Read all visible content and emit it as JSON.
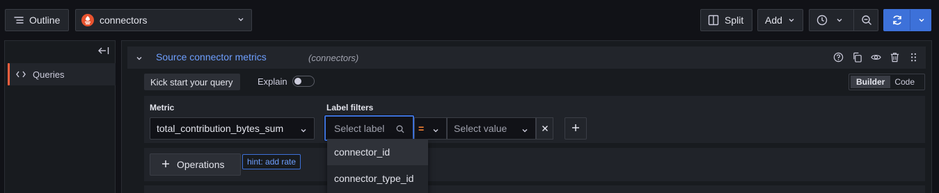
{
  "toolbar": {
    "outline_label": "Outline",
    "datasource_name": "connectors",
    "split_label": "Split",
    "add_label": "Add"
  },
  "sidebar": {
    "items": [
      {
        "label": "Queries",
        "active": true
      }
    ]
  },
  "query": {
    "title": "Source connector metrics",
    "datasource": "(connectors)",
    "kick_start_label": "Kick start your query",
    "explain_label": "Explain",
    "explain_enabled": false,
    "mode_builder": "Builder",
    "mode_code": "Code",
    "active_mode": "Builder",
    "metric_label": "Metric",
    "metric_value": "total_contribution_bytes_sum",
    "label_filters_label": "Label filters",
    "label_placeholder": "Select label",
    "operator": "=",
    "value_placeholder": "Select value",
    "operations_label": "Operations",
    "hint": "hint: add rate"
  },
  "dropdown": {
    "options": [
      "connector_id",
      "connector_type_id"
    ]
  },
  "colors": {
    "accent": "#3d71d9",
    "link": "#6e9fff",
    "active_marker": "#f55f3e",
    "operator": "#ff8833",
    "datasource_logo": "#e8532f"
  }
}
